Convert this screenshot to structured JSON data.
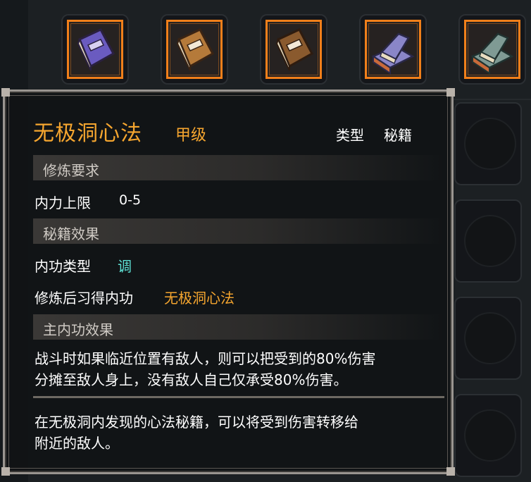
{
  "inventory": {
    "top_slots": [
      {
        "icon": "purple-book-icon",
        "color": "#7a6bd0"
      },
      {
        "icon": "brown-book-icon",
        "color": "#b57a3a"
      },
      {
        "icon": "brown-book-icon",
        "color": "#8a5a2e"
      },
      {
        "icon": "stacked-purple-books-icon",
        "color": "#8a86c8"
      },
      {
        "icon": "stacked-teal-books-icon",
        "color": "#7f9a94"
      }
    ],
    "accent_color": "#f07f1a"
  },
  "tooltip": {
    "title": "无极洞心法",
    "grade": "甲级",
    "type_label": "类型",
    "type_value": "秘籍",
    "section_requirements": "修炼要求",
    "req_label": "内力上限",
    "req_value": "0-5",
    "section_effects": "秘籍效果",
    "skill_type_label": "内功类型",
    "skill_type_value": "调",
    "learned_label": "修炼后习得内功",
    "learned_value": "无极洞心法",
    "section_main": "主内功效果",
    "main_effect_line1": "战斗时如果临近位置有敌人，则可以把受到的80%伤害",
    "main_effect_line2": "分摊至敌人身上，没有敌人自己仅承受80%伤害。",
    "flavor_line1": "在无极洞内发现的心法秘籍，可以将受到伤害转移给",
    "flavor_line2": "附近的敌人。",
    "title_color": "#f6a62f",
    "cyan_color": "#5fe3d6"
  }
}
